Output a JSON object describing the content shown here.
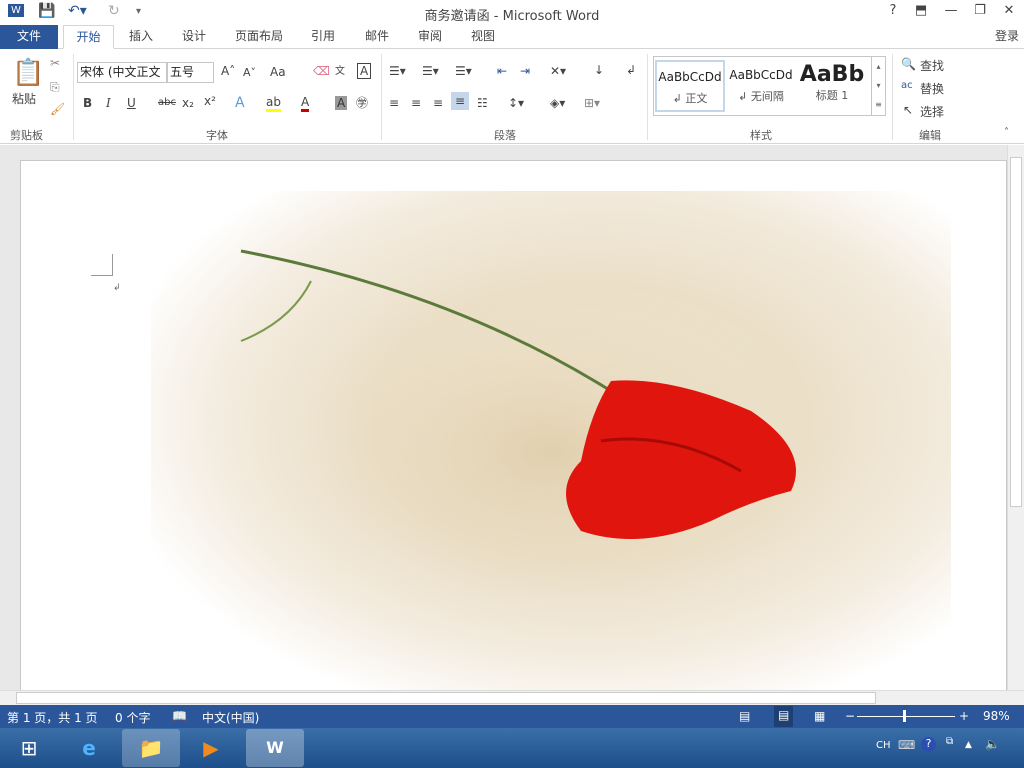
{
  "window": {
    "title": "商务邀请函 - Microsoft Word",
    "help": "?",
    "login": "登录"
  },
  "tabs": [
    {
      "label": "文件"
    },
    {
      "label": "开始"
    },
    {
      "label": "插入"
    },
    {
      "label": "设计"
    },
    {
      "label": "页面布局"
    },
    {
      "label": "引用"
    },
    {
      "label": "邮件"
    },
    {
      "label": "审阅"
    },
    {
      "label": "视图"
    }
  ],
  "ribbon": {
    "clipboard": {
      "paste": "粘贴",
      "group": "剪贴板"
    },
    "font": {
      "name": "宋体 (中文正文",
      "size": "五号",
      "group": "字体",
      "bold": "B",
      "italic": "I",
      "underline": "U",
      "strike": "abc",
      "change_case": "Aa"
    },
    "paragraph": {
      "group": "段落"
    },
    "styles": {
      "group": "样式",
      "items": [
        {
          "preview": "AaBbCcDd",
          "name": "↲ 正文"
        },
        {
          "preview": "AaBbCcDd",
          "name": "↲ 无间隔"
        },
        {
          "preview": "AaBb",
          "name": "标题 1"
        }
      ]
    },
    "editing": {
      "group": "编辑",
      "find": "查找",
      "replace": "替换",
      "select": "选择"
    }
  },
  "status": {
    "page": "第 1 页，共 1 页",
    "words": "0 个字",
    "language": "中文(中国)",
    "zoom": "98%",
    "zoom_value": 98
  },
  "taskbar": {
    "ime": "CH"
  },
  "colors": {
    "accent": "#2b579a"
  }
}
